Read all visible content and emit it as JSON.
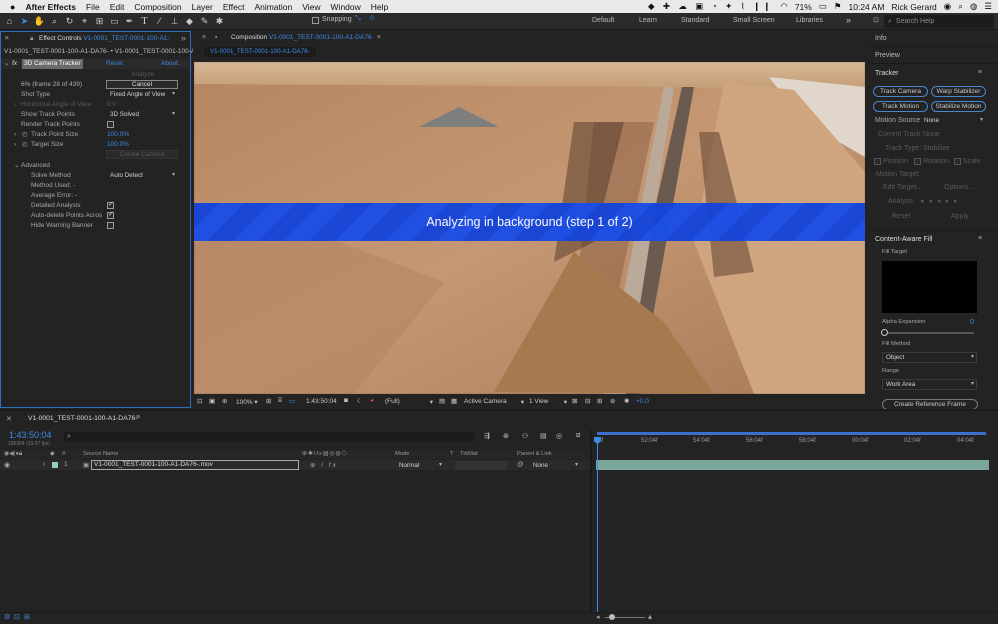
{
  "menubar": {
    "apple": "",
    "app": "After Effects",
    "items": [
      "File",
      "Edit",
      "Composition",
      "Layer",
      "Effect",
      "Animation",
      "View",
      "Window",
      "Help"
    ],
    "battery": "71%",
    "time": "10:24 AM",
    "user": "Rick Gerard"
  },
  "toolbar": {
    "snapping": "Snapping",
    "workspaces": [
      "Default",
      "Learn",
      "Standard",
      "Small Screen",
      "Libraries"
    ],
    "search_placeholder": "Search Help",
    "more": "»"
  },
  "effect_controls": {
    "tab": "Effect Controls",
    "tab_file": "V1-0001_TEST-0001-100-A1-",
    "layer_path_a": "V1-0001_TEST-0001-100-A1-DA76-",
    "layer_path_b": " • V1-0001_TEST-0001-100-A1-DA76-",
    "effect_name": "3D Camera Tracker",
    "reset": "Reset",
    "about": "About.",
    "analyze": "Analyze",
    "progress": "6% (frame 28 of 439)",
    "cancel": "Cancel",
    "shot_type_label": "Shot Type",
    "shot_type_value": "Fixed Angle of View",
    "hav_label": "Horizontal Angle of View",
    "hav_value": "0.0",
    "show_tp_label": "Show Track Points",
    "show_tp_value": "3D Solved",
    "render_tp_label": "Render Track Points",
    "tp_size_label": "Track Point Size",
    "tp_size_value": "100.0%",
    "target_size_label": "Target Size",
    "target_size_value": "100.0%",
    "create_camera": "Create Camera",
    "advanced": "Advanced",
    "solve_method_label": "Solve Method",
    "solve_method_value": "Auto Detect",
    "method_used": "Method Used: -",
    "avg_error": "Average Error: -",
    "detailed": "Detailed Analysis",
    "auto_delete": "Auto-delete Points Acros",
    "hide_warning": "Hide Warning Banner"
  },
  "composition": {
    "tab_prefix": "Composition",
    "tab_name": "V1-0001_TEST-0001-100-A1-DA76-",
    "subtab": "V1-0001_TEST-0001-100-A1-DA76-",
    "banner": "Analyzing in background (step 1 of 2)",
    "footer": {
      "zoom": "100%",
      "timecode": "1:43:50:04",
      "resolution": "(Full)",
      "camera": "Active Camera",
      "view": "1 View",
      "exposure": "+0.0"
    }
  },
  "right_panel": {
    "info": "Info",
    "preview": "Preview",
    "tracker": "Tracker",
    "track_camera": "Track Camera",
    "warp_stabilizer": "Warp Stabilizer",
    "track_motion": "Track Motion",
    "stabilize_motion": "Stabilize Motion",
    "motion_source_label": "Motion Source:",
    "motion_source_value": "None",
    "current_track_label": "Current Track:",
    "current_track_value": "None",
    "track_type_label": "Track Type:",
    "track_type_value": "Stabilize",
    "position": "Position",
    "rotation": "Rotation",
    "scale": "Scale",
    "motion_target": "Motion Target:",
    "edit_target": "Edit Target...",
    "options": "Options...",
    "analyze": "Analyze:",
    "reset": "Reset",
    "apply": "Apply",
    "caf": "Content-Aware Fill",
    "fill_target": "Fill Target",
    "alpha_expansion": "Alpha Expansion",
    "alpha_value": "0",
    "fill_method": "Fill Method",
    "fill_method_value": "Object",
    "range": "Range",
    "range_value": "Work Area",
    "create_ref": "Create Reference Frame"
  },
  "timeline": {
    "tab": "V1-0001_TEST-0001-100-A1-DA76-",
    "timecode": "1:43:50:04",
    "fps": "186904 (29.97 fps)",
    "headers": {
      "num": "#",
      "source": "Source Name",
      "mode": "Mode",
      "t": "T",
      "trkmat": "TrkMat",
      "parent": "Parent & Link"
    },
    "layer": {
      "num": "1",
      "name": "V1-0001_TEST-0001-100-A1-DA76-.mov",
      "mode": "Normal",
      "parent": "None"
    },
    "ruler": [
      "4f",
      "52:04f",
      "54:04f",
      "56:04f",
      "58:04f",
      "00:04f",
      "02:04f",
      "04:04f"
    ]
  }
}
